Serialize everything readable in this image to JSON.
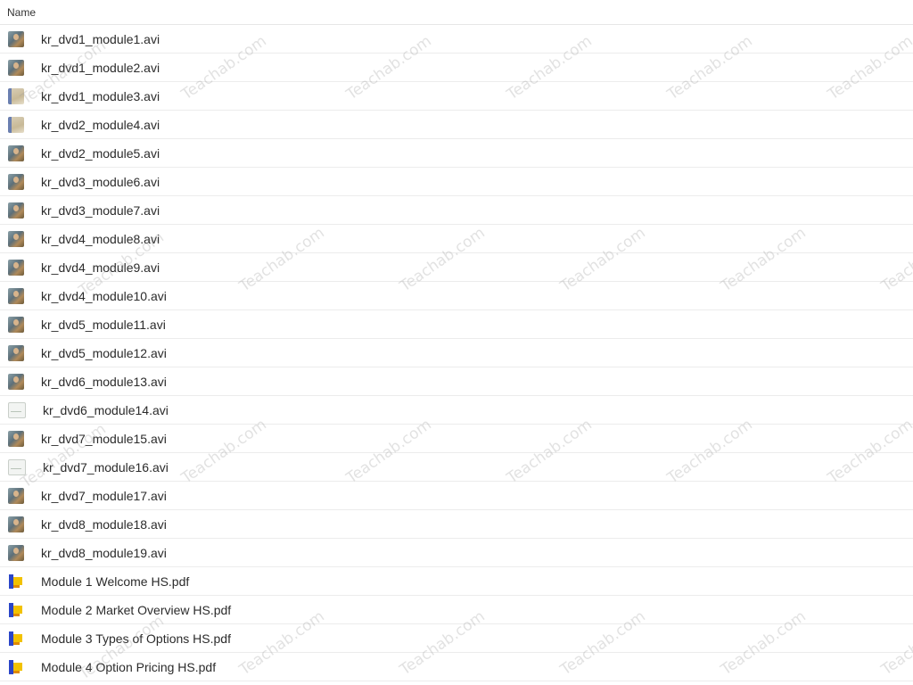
{
  "header": {
    "column_name": "Name"
  },
  "files": [
    {
      "name": "kr_dvd1_module1.avi",
      "type": "video",
      "thumb": "person"
    },
    {
      "name": "kr_dvd1_module2.avi",
      "type": "video",
      "thumb": "person"
    },
    {
      "name": "kr_dvd1_module3.avi",
      "type": "video",
      "thumb": "chart"
    },
    {
      "name": "kr_dvd2_module4.avi",
      "type": "video",
      "thumb": "chart"
    },
    {
      "name": "kr_dvd2_module5.avi",
      "type": "video",
      "thumb": "person"
    },
    {
      "name": "kr_dvd3_module6.avi",
      "type": "video",
      "thumb": "person"
    },
    {
      "name": "kr_dvd3_module7.avi",
      "type": "video",
      "thumb": "person"
    },
    {
      "name": "kr_dvd4_module8.avi",
      "type": "video",
      "thumb": "person"
    },
    {
      "name": "kr_dvd4_module9.avi",
      "type": "video",
      "thumb": "person"
    },
    {
      "name": "kr_dvd4_module10.avi",
      "type": "video",
      "thumb": "person"
    },
    {
      "name": "kr_dvd5_module11.avi",
      "type": "video",
      "thumb": "person"
    },
    {
      "name": "kr_dvd5_module12.avi",
      "type": "video",
      "thumb": "person"
    },
    {
      "name": "kr_dvd6_module13.avi",
      "type": "video",
      "thumb": "person"
    },
    {
      "name": "kr_dvd6_module14.avi",
      "type": "video",
      "thumb": "blank"
    },
    {
      "name": "kr_dvd7_module15.avi",
      "type": "video",
      "thumb": "person"
    },
    {
      "name": "kr_dvd7_module16.avi",
      "type": "video",
      "thumb": "blank"
    },
    {
      "name": "kr_dvd7_module17.avi",
      "type": "video",
      "thumb": "person"
    },
    {
      "name": "kr_dvd8_module18.avi",
      "type": "video",
      "thumb": "person"
    },
    {
      "name": "kr_dvd8_module19.avi",
      "type": "video",
      "thumb": "person"
    },
    {
      "name": "Module 1 Welcome HS.pdf",
      "type": "pdf",
      "thumb": "pdf"
    },
    {
      "name": "Module 2 Market Overview HS.pdf",
      "type": "pdf",
      "thumb": "pdf"
    },
    {
      "name": "Module 3 Types of Options HS.pdf",
      "type": "pdf",
      "thumb": "pdf"
    },
    {
      "name": "Module 4 Option Pricing HS.pdf",
      "type": "pdf",
      "thumb": "pdf"
    }
  ],
  "watermark": {
    "text": "Teachab.com"
  }
}
